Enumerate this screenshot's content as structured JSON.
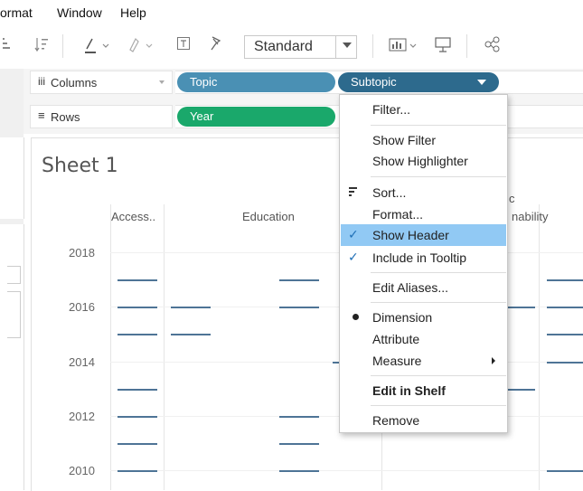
{
  "menubar": {
    "items": [
      "ormat",
      "Window",
      "Help"
    ]
  },
  "toolbar": {
    "format_dropdown": "Standard",
    "icons": [
      "sort-icon",
      "highlight-icon",
      "pin-icon",
      "label-icon",
      "annotate-icon",
      "show-me-icon",
      "presentation-icon",
      "share-icon"
    ]
  },
  "shelves": {
    "columns_label": "Columns",
    "rows_label": "Rows",
    "columns_pills": [
      "Topic",
      "Subtopic"
    ],
    "rows_pills": [
      "Year"
    ]
  },
  "sheet": {
    "title": "Sheet 1",
    "col_headers": [
      "Access..",
      "Education",
      "nability"
    ],
    "topic_partial": "c",
    "years": [
      "2018",
      "2016",
      "2014",
      "2012",
      "2010"
    ]
  },
  "context_menu": {
    "items": [
      {
        "label": "Filter..."
      },
      {
        "label": "Show Filter"
      },
      {
        "label": "Show Highlighter"
      },
      {
        "label": "Sort..."
      },
      {
        "label": "Format..."
      },
      {
        "label": "Show Header",
        "checked": true,
        "highlighted": true
      },
      {
        "label": "Include in Tooltip",
        "checked": true
      },
      {
        "label": "Edit Aliases..."
      },
      {
        "label": "Dimension",
        "selected": true
      },
      {
        "label": "Attribute"
      },
      {
        "label": "Measure"
      },
      {
        "label": "Edit in Shelf"
      },
      {
        "label": "Remove"
      }
    ]
  },
  "colors": {
    "pill_topic": "#4a90b4",
    "pill_subtopic": "#2d6a8d",
    "pill_year": "#1aa86b",
    "mark": "#4e7496",
    "menu_highlight": "#91c9f4"
  }
}
